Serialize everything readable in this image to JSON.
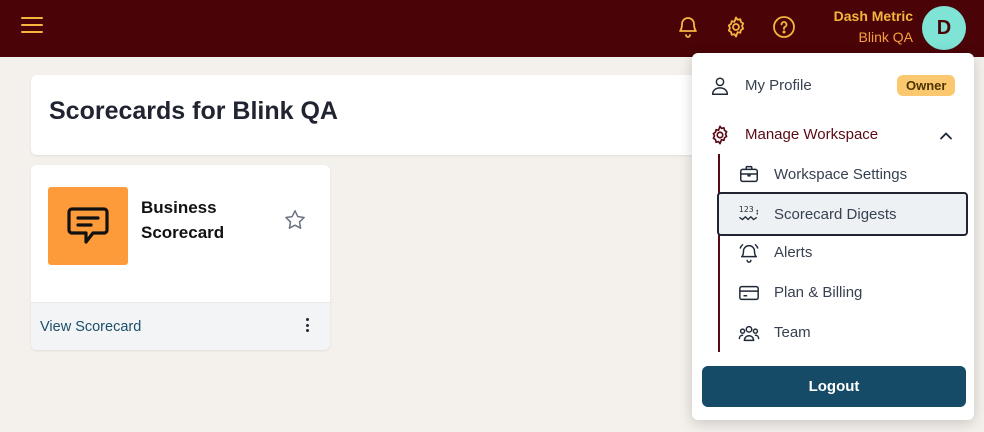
{
  "header": {
    "user_name": "Dash Metric",
    "workspace_name": "Blink QA",
    "avatar_initial": "D"
  },
  "page": {
    "title": "Scorecards for Blink QA"
  },
  "scorecard": {
    "name": "Business Scorecard",
    "view_link": "View Scorecard"
  },
  "menu": {
    "profile_label": "My Profile",
    "role_badge": "Owner",
    "manage_label": "Manage Workspace",
    "sub_items": {
      "workspace_settings": "Workspace Settings",
      "scorecard_digests": "Scorecard Digests",
      "alerts": "Alerts",
      "plan_billing": "Plan & Billing",
      "team": "Team"
    },
    "logout_label": "Logout"
  },
  "colors": {
    "topbar": "#4a0408",
    "accent": "#f5b53f",
    "primary_button": "#154b66",
    "avatar": "#7fe3d6",
    "scorecard_thumb": "#fd9a3a"
  }
}
